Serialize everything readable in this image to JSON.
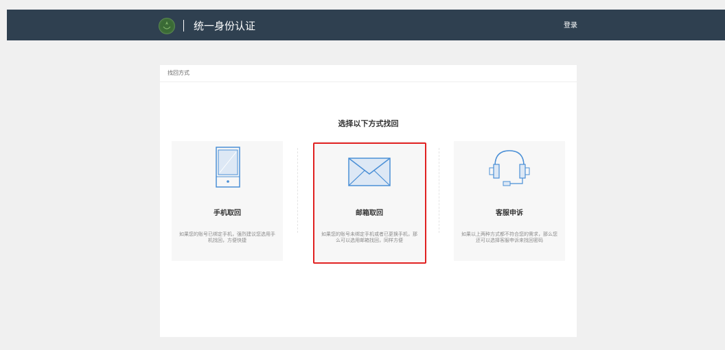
{
  "header": {
    "title": "统一身份认证",
    "login_label": "登录"
  },
  "breadcrumb": {
    "label": "找回方式"
  },
  "main": {
    "heading": "选择以下方式找回",
    "options": [
      {
        "label": "手机取回",
        "description": "如果您的账号已绑定手机，强烈建议您选用手机找回，方便快捷",
        "icon": "phone-icon"
      },
      {
        "label": "邮箱取回",
        "description": "如果您的账号未绑定手机或者已更换手机，那么可以选用邮箱找回，同样方便",
        "icon": "mail-icon",
        "selected": true
      },
      {
        "label": "客服申诉",
        "description": "如果以上两种方式都不符合您的需求，那么您还可以选择客服申诉来找回密码",
        "icon": "headset-icon"
      }
    ]
  },
  "colors": {
    "topbar": "#2f4050",
    "icon_blue": "#4a8fd6",
    "selection_outline": "#e02020"
  }
}
